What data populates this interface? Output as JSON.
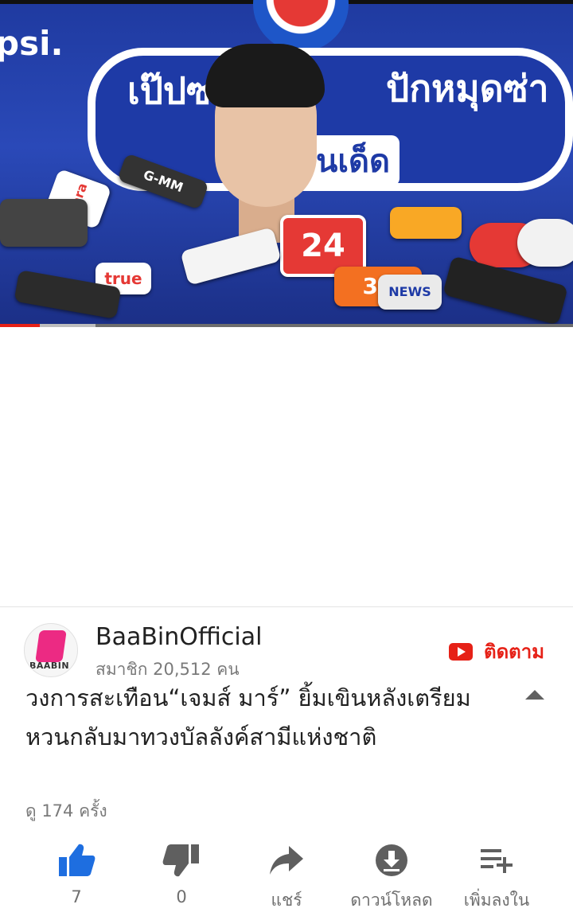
{
  "video": {
    "brand_text": "psi.",
    "banner_left": "เป๊ปซ",
    "banner_right": "ปักหมุดซ่า",
    "banner_sub": "นเด็ด",
    "mic_labels": [
      "24",
      "true",
      "38",
      "dara",
      "G-MM",
      "NEWS"
    ],
    "progress_fraction": 0.07,
    "colors": {
      "progress": "#e62117",
      "banner": "#1e3aa6"
    }
  },
  "title": "วงการสะเทือน“เจมส์ มาร์” ยิ้มเขินหลังเตรียมหวนกลับมาทวงบัลลังค์สามีแห่งชาติ",
  "views": "ดู 174 ครั้ง",
  "actions": [
    {
      "name": "like",
      "icon": "thumbs-up-icon",
      "label": "7",
      "color": "#1e6ee0"
    },
    {
      "name": "dislike",
      "icon": "thumbs-down-icon",
      "label": "0",
      "color": "#5f5f5f"
    },
    {
      "name": "share",
      "icon": "share-icon",
      "label": "แชร์",
      "color": "#5f5f5f"
    },
    {
      "name": "download",
      "icon": "download-icon",
      "label": "ดาวน์โหลด",
      "color": "#5f5f5f"
    },
    {
      "name": "add-to",
      "icon": "playlist-add-icon",
      "label": "เพิ่มลงใน",
      "color": "#5f5f5f"
    }
  ],
  "channel": {
    "name": "BaaBinOfficial",
    "subscribers": "สมาชิก 20,512 คน",
    "avatar_text": "BAABIN",
    "subscribe_label": "ติดตาม",
    "brand_color": "#e62117"
  }
}
